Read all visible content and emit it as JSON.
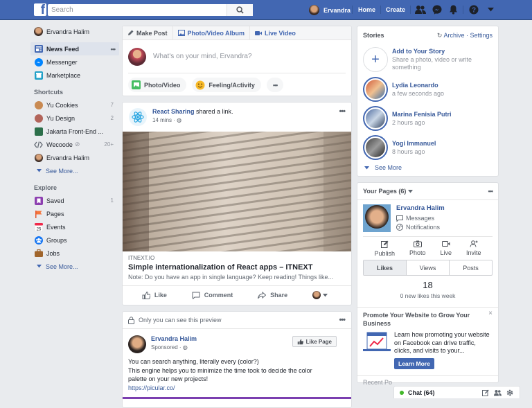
{
  "topbar": {
    "search_placeholder": "Search",
    "user_name": "Ervandra",
    "home": "Home",
    "create": "Create"
  },
  "left": {
    "profile": "Ervandra Halim",
    "items": [
      {
        "label": "News Feed",
        "more": "•••"
      },
      {
        "label": "Messenger"
      },
      {
        "label": "Marketplace"
      }
    ],
    "shortcuts_title": "Shortcuts",
    "shortcuts": [
      {
        "label": "Yu Cookies",
        "count": "7"
      },
      {
        "label": "Yu Design",
        "count": "2"
      },
      {
        "label": "Jakarta Front-End ...",
        "count": ""
      },
      {
        "label": "Wecoode",
        "count": "20+"
      },
      {
        "label": "Ervandra Halim",
        "count": ""
      }
    ],
    "see_more_1": "See More...",
    "explore_title": "Explore",
    "explore": [
      {
        "label": "Saved",
        "count": "1"
      },
      {
        "label": "Pages"
      },
      {
        "label": "Events"
      },
      {
        "label": "Groups"
      },
      {
        "label": "Jobs"
      }
    ],
    "see_more_2": "See More...",
    "events_day": "25"
  },
  "composer": {
    "tabs": [
      "Make Post",
      "Photo/Video Album",
      "Live Video"
    ],
    "placeholder": "What's on your mind, Ervandra?",
    "pills": [
      "Photo/Video",
      "Feeling/Activity"
    ],
    "more": "•••"
  },
  "post1": {
    "author": "React Sharing",
    "action": " shared a link.",
    "time": "14 mins · ",
    "more": "•••",
    "link_domain": "ITNEXT.IO",
    "link_title": "Simple internationalization of React apps – ITNEXT",
    "link_desc": "Note: Do you have an app in single language? Keep reading! Things like...",
    "actions": [
      "Like",
      "Comment",
      "Share"
    ]
  },
  "post2": {
    "notice": "Only you can see this preview",
    "more": "•••",
    "author": "Ervandra Halim",
    "sponsored": "Sponsored · ",
    "like_page": "Like Page",
    "text_lines": [
      "You can search anything, literally every (color?)",
      "This engine helps you to minimize the time took to decide the color",
      "palette on your new projects!"
    ],
    "link": "https://picular.co/"
  },
  "stories": {
    "title": "Stories",
    "links": "Archive · Settings",
    "add_title": "Add to Your Story",
    "add_sub": "Share a photo, video or write something",
    "items": [
      {
        "name": "Lydia Leonardo",
        "time": "a few seconds ago"
      },
      {
        "name": "Marina Fenisia Putri",
        "time": "2 hours ago"
      },
      {
        "name": "Yogi Immanuel",
        "time": "8 hours ago"
      }
    ],
    "see_more": "See More"
  },
  "pages": {
    "title": "Your Pages (6)",
    "more": "•••",
    "page_name": "Ervandra Halim",
    "messages": "Messages",
    "notifications": "Notifications",
    "actions": [
      "Publish",
      "Photo",
      "Live",
      "Invite"
    ],
    "tabs": [
      "Likes",
      "Views",
      "Posts"
    ],
    "count": "18",
    "count_sub": "0 new likes this week",
    "promo_title": "Promote Your Website to Grow Your Business",
    "promo_close": "×",
    "promo_text": "Learn how promoting your website on Facebook can drive traffic, clicks, and visits to your...",
    "learn_more": "Learn More",
    "recent": "Recent Po"
  },
  "chat": {
    "label": "Chat (64)"
  },
  "colors": {
    "brand": "#4267b2",
    "link": "#365899",
    "bg": "#e9ebee"
  }
}
